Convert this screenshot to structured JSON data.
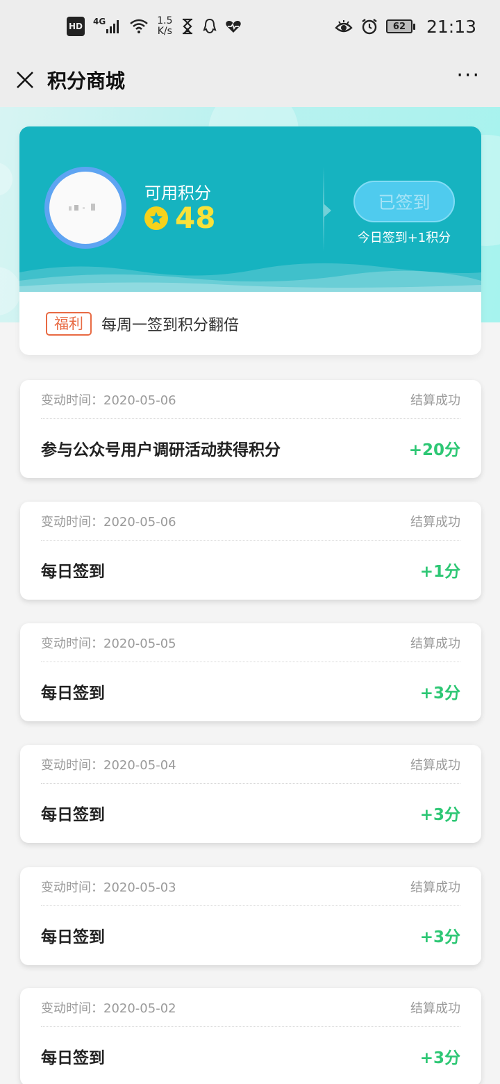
{
  "status_bar": {
    "hd": "HD",
    "signal": "4G",
    "net_speed_value": "1.5",
    "net_speed_unit": "K/s",
    "battery": "62",
    "time": "21:13",
    "icons": [
      "hd-icon",
      "signal-icon",
      "wifi-icon",
      "hourglass-icon",
      "qq-icon",
      "health-icon",
      "eye-icon",
      "alarm-icon",
      "battery-icon"
    ]
  },
  "nav": {
    "title": "积分商城",
    "more": "···"
  },
  "points_card": {
    "label": "可用积分",
    "value": "48",
    "signin_button": "已签到",
    "signin_hint": "今日签到+1积分",
    "benefit_tag": "福利",
    "benefit_text": "每周一签到积分翻倍"
  },
  "records": [
    {
      "time_label": "变动时间：2020-05-06",
      "status": "结算成功",
      "title": "参与公众号用户调研活动获得积分",
      "points": "+20分"
    },
    {
      "time_label": "变动时间：2020-05-06",
      "status": "结算成功",
      "title": "每日签到",
      "points": "+1分"
    },
    {
      "time_label": "变动时间：2020-05-05",
      "status": "结算成功",
      "title": "每日签到",
      "points": "+3分"
    },
    {
      "time_label": "变动时间：2020-05-04",
      "status": "结算成功",
      "title": "每日签到",
      "points": "+3分"
    },
    {
      "time_label": "变动时间：2020-05-03",
      "status": "结算成功",
      "title": "每日签到",
      "points": "+3分"
    },
    {
      "time_label": "变动时间：2020-05-02",
      "status": "结算成功",
      "title": "每日签到",
      "points": "+3分"
    }
  ],
  "colors": {
    "card_teal": "#16b3c0",
    "points_yellow": "#f8e23a",
    "benefit_orange": "#e86a43",
    "positive_green": "#2dc774"
  }
}
